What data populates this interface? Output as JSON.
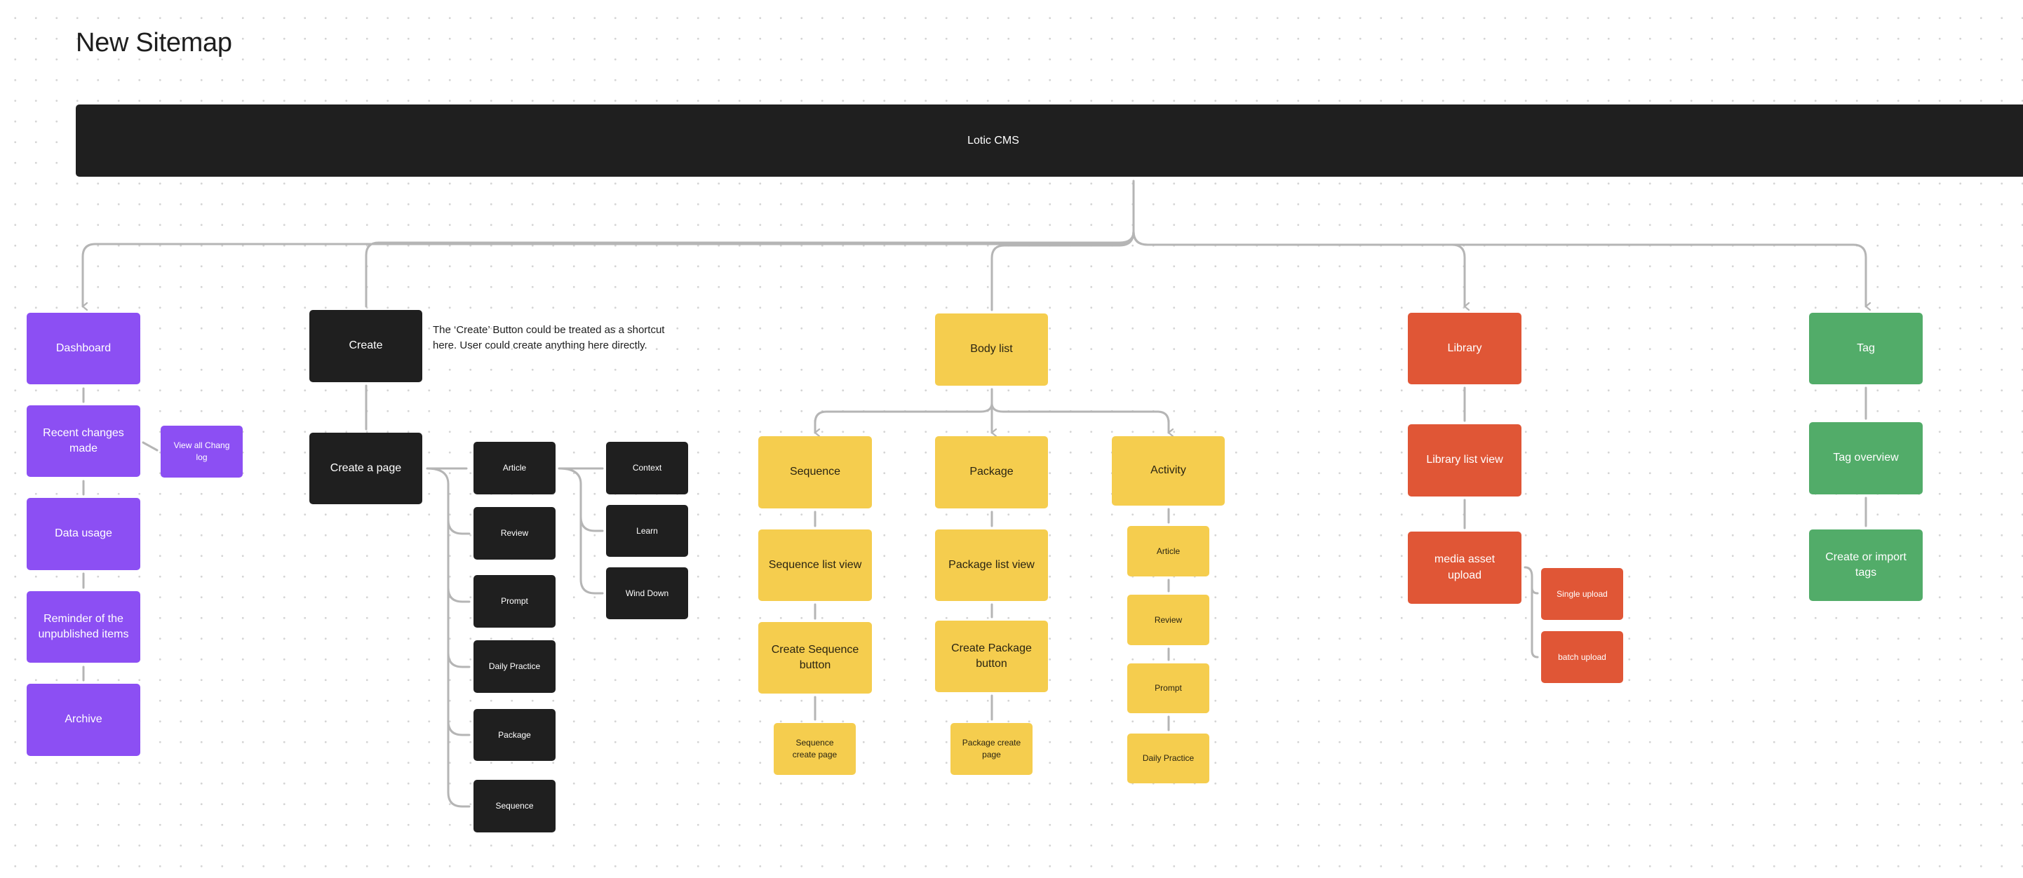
{
  "title": "New Sitemap",
  "root": {
    "label": "Lotic CMS"
  },
  "colors": {
    "dashboard": "#8c4ff3",
    "create": "#1f1f1f",
    "body_list": "#f5cd4e",
    "library": "#e05636",
    "tag": "#52ac69",
    "connector": "#b5b5b5"
  },
  "dashboard": {
    "label": "Dashboard",
    "children": [
      {
        "label": "Recent changes made",
        "sub": "View all Chang log"
      },
      {
        "label": "Data usage"
      },
      {
        "label": "Reminder of the unpublished items"
      },
      {
        "label": "Archive"
      }
    ]
  },
  "create": {
    "label": "Create",
    "note": "The ‘Create’ Button could be treated as a shortcut here. User could create anything here directly.",
    "create_page": {
      "label": "Create a page",
      "types": [
        "Article",
        "Review",
        "Prompt",
        "Daily Practice",
        "Package",
        "Sequence"
      ],
      "article_subtypes": [
        "Context",
        "Learn",
        "Wind Down"
      ]
    }
  },
  "body_list": {
    "label": "Body list",
    "sequence": {
      "label": "Sequence",
      "children": [
        "Sequence list view",
        "Create Sequence button",
        "Sequence create page"
      ]
    },
    "package": {
      "label": "Package",
      "children": [
        "Package list view",
        "Create Package button",
        "Package create page"
      ]
    },
    "activity": {
      "label": "Activity",
      "children": [
        "Article",
        "Review",
        "Prompt",
        "Daily Practice"
      ]
    }
  },
  "library": {
    "label": "Library",
    "children": [
      "Library list view",
      "media asset upload"
    ],
    "upload_options": [
      "Single upload",
      "batch upload"
    ]
  },
  "tag": {
    "label": "Tag",
    "children": [
      "Tag overview",
      "Create or import tags"
    ]
  }
}
